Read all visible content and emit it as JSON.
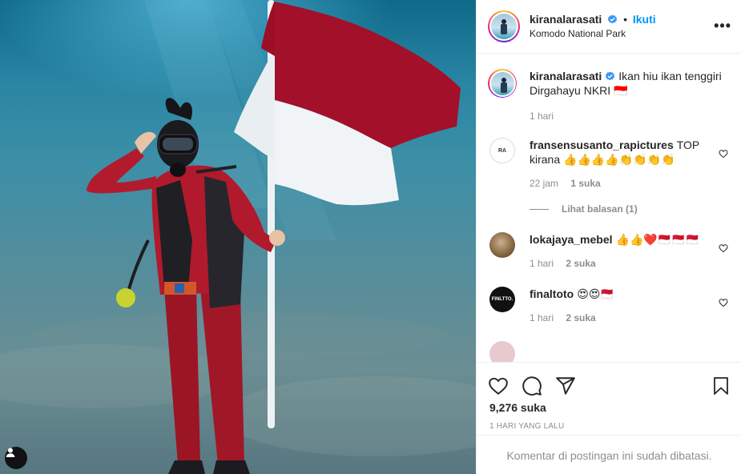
{
  "post": {
    "username": "kiranalarasati",
    "follow_label": "Ikuti",
    "separator": "•",
    "location": "Komodo National Park",
    "more_label": "•••"
  },
  "caption": {
    "username": "kiranalarasati",
    "text": "Ikan hiu ikan tenggiri Dirgahayu NKRI 🇮🇩",
    "time": "1 hari"
  },
  "comments": [
    {
      "username": "fransensusanto_rapictures",
      "text": "TOP kirana 👍👍👍👍👏👏👏👏",
      "time": "22 jam",
      "likes": "1 suka",
      "replies": "Lihat balasan (1)"
    },
    {
      "username": "lokajaya_mebel",
      "text": "👍👍❤️🇲🇨🇲🇨🇲🇨",
      "time": "1 hari",
      "likes": "2 suka"
    },
    {
      "username": "finaltoto",
      "text": "😍😍🇲🇨",
      "time": "1 hari",
      "likes": "2 suka"
    }
  ],
  "avatars": {
    "c0_logo": "RA",
    "c2_logo": "FINLTTO."
  },
  "stats": {
    "likes": "9,276 suka",
    "date": "1 HARI YANG LALU"
  },
  "footer": {
    "limited_text": "Komentar di postingan ini sudah dibatasi."
  },
  "colors": {
    "accent": "#0095f6",
    "flag_red": "#b0112a",
    "flag_white": "#f1f4f6"
  },
  "icons": [
    "verified-badge-icon",
    "more-options-icon",
    "heart-icon",
    "comment-icon",
    "share-icon",
    "bookmark-icon",
    "user-tag-icon"
  ]
}
